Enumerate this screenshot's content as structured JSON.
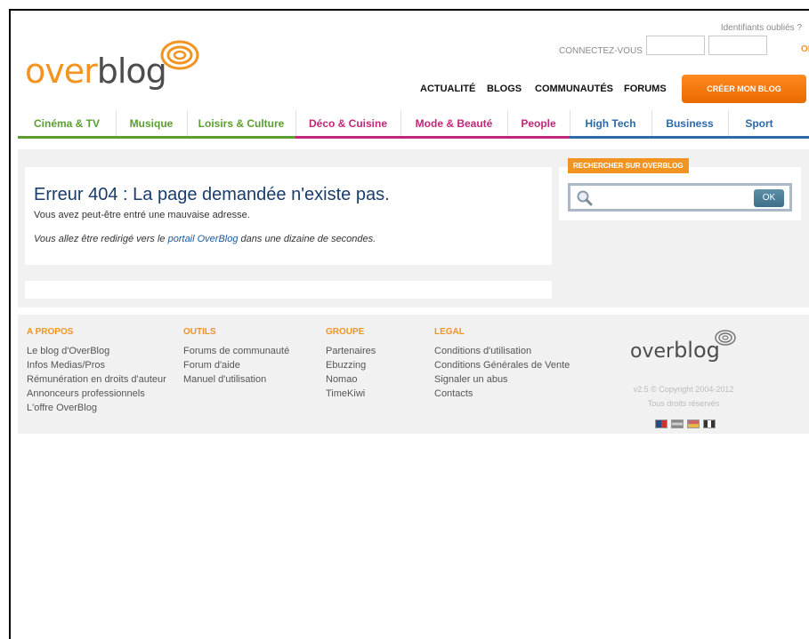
{
  "header": {
    "logo_over": "over",
    "logo_blog": "blog",
    "forgot_label": "Identifiants oubliés ?",
    "connect_label": "CONNECTEZ-VOUS",
    "login_ok": "OK",
    "nav": [
      "ACTUALITÉ",
      "BLOGS",
      "COMMUNAUTÉS",
      "FORUMS"
    ],
    "create_label": "CRÉER MON BLOG"
  },
  "categories": [
    {
      "label": "Cinéma & TV",
      "color": "#5a9e2f"
    },
    {
      "label": "Musique",
      "color": "#5a9e2f"
    },
    {
      "label": "Loisirs & Culture",
      "color": "#5a9e2f"
    },
    {
      "label": "Déco & Cuisine",
      "color": "#c2277a"
    },
    {
      "label": "Mode & Beauté",
      "color": "#c2277a"
    },
    {
      "label": "People",
      "color": "#c2277a"
    },
    {
      "label": "High Tech",
      "color": "#2b6aa8"
    },
    {
      "label": "Business",
      "color": "#2b6aa8"
    },
    {
      "label": "Sport",
      "color": "#2b6aa8"
    }
  ],
  "error": {
    "title": "Erreur 404 : La page demandée n'existe pas.",
    "subtitle": "Vous avez peut-être entré une mauvaise adresse.",
    "redirect_before": "Vous allez être redirigé vers le ",
    "redirect_link": "portail OverBlog",
    "redirect_after": " dans une dizaine de secondes."
  },
  "search": {
    "tag": "RECHERCHER SUR OVERBLOG",
    "ok_label": "OK",
    "value": ""
  },
  "footer": {
    "columns": [
      {
        "heading": "A PROPOS",
        "links": [
          "Le blog d'OverBlog",
          "Infos Medias/Pros",
          "Rémunération en droits d'auteur",
          "Annonceurs professionnels",
          "L'offre OverBlog"
        ]
      },
      {
        "heading": "OUTILS",
        "links": [
          "Forums de communauté",
          "Forum d'aide",
          "Manuel d'utilisation"
        ]
      },
      {
        "heading": "GROUPE",
        "links": [
          "Partenaires",
          "Ebuzzing",
          "Nomao",
          "TimeKiwi"
        ]
      },
      {
        "heading": "LEGAL",
        "links": [
          "Conditions d'utilisation",
          "Conditions Générales de Vente",
          "Signaler un abus",
          "Contacts"
        ]
      }
    ],
    "logo_over": "over",
    "logo_blog": "blog",
    "version": "v2.5 © Copyright 2004-2012",
    "rights": "Tous droits réservés"
  },
  "colors": {
    "accent": "#f29422",
    "title_blue": "#1a3c6e"
  }
}
